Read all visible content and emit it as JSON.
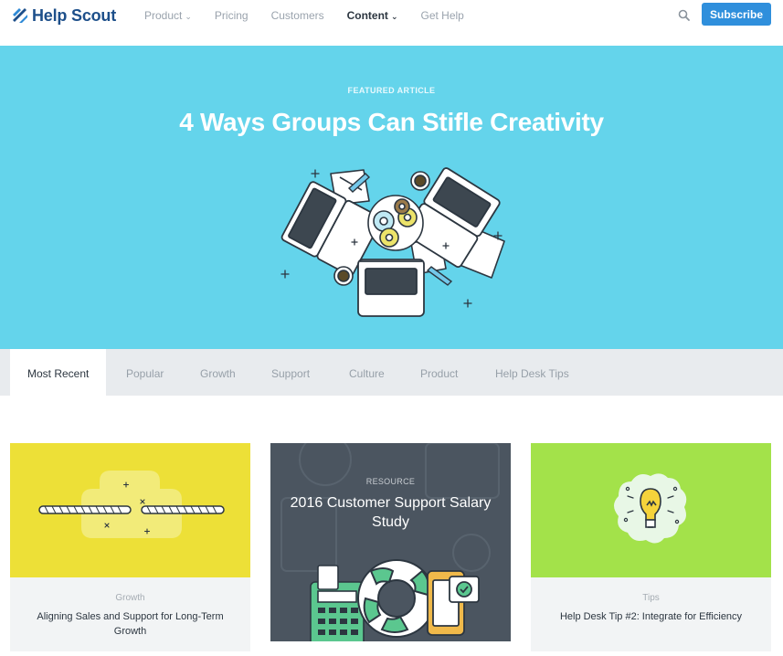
{
  "header": {
    "brand": "Help Scout",
    "nav": [
      {
        "label": "Product",
        "has_dropdown": true,
        "active": false
      },
      {
        "label": "Pricing",
        "has_dropdown": false,
        "active": false
      },
      {
        "label": "Customers",
        "has_dropdown": false,
        "active": false
      },
      {
        "label": "Content",
        "has_dropdown": true,
        "active": true
      },
      {
        "label": "Get Help",
        "has_dropdown": false,
        "active": false
      }
    ],
    "search_icon": "search-icon",
    "subscribe_label": "Subscribe"
  },
  "hero": {
    "kicker": "FEATURED ARTICLE",
    "title": "4 Ways Groups Can Stifle Creativity",
    "background": "#64d4eb"
  },
  "tabs": [
    "Most Recent",
    "Popular",
    "Growth",
    "Support",
    "Culture",
    "Product",
    "Help Desk Tips"
  ],
  "active_tab": "Most Recent",
  "cards": [
    {
      "category": "Growth",
      "title": "Aligning Sales and Support for Long-Term Growth",
      "image_color": "#ede037"
    },
    {
      "kicker": "RESOURCE",
      "title": "2016 Customer Support Salary Study",
      "image_color": "#4b5560"
    },
    {
      "category": "Tips",
      "title": "Help Desk Tip #2: Integrate for Efficiency",
      "image_color": "#a3e24a"
    }
  ],
  "colors": {
    "brand": "#1d4f8a",
    "accent": "#2f8fdc",
    "tab_bar": "#e8ebee"
  }
}
